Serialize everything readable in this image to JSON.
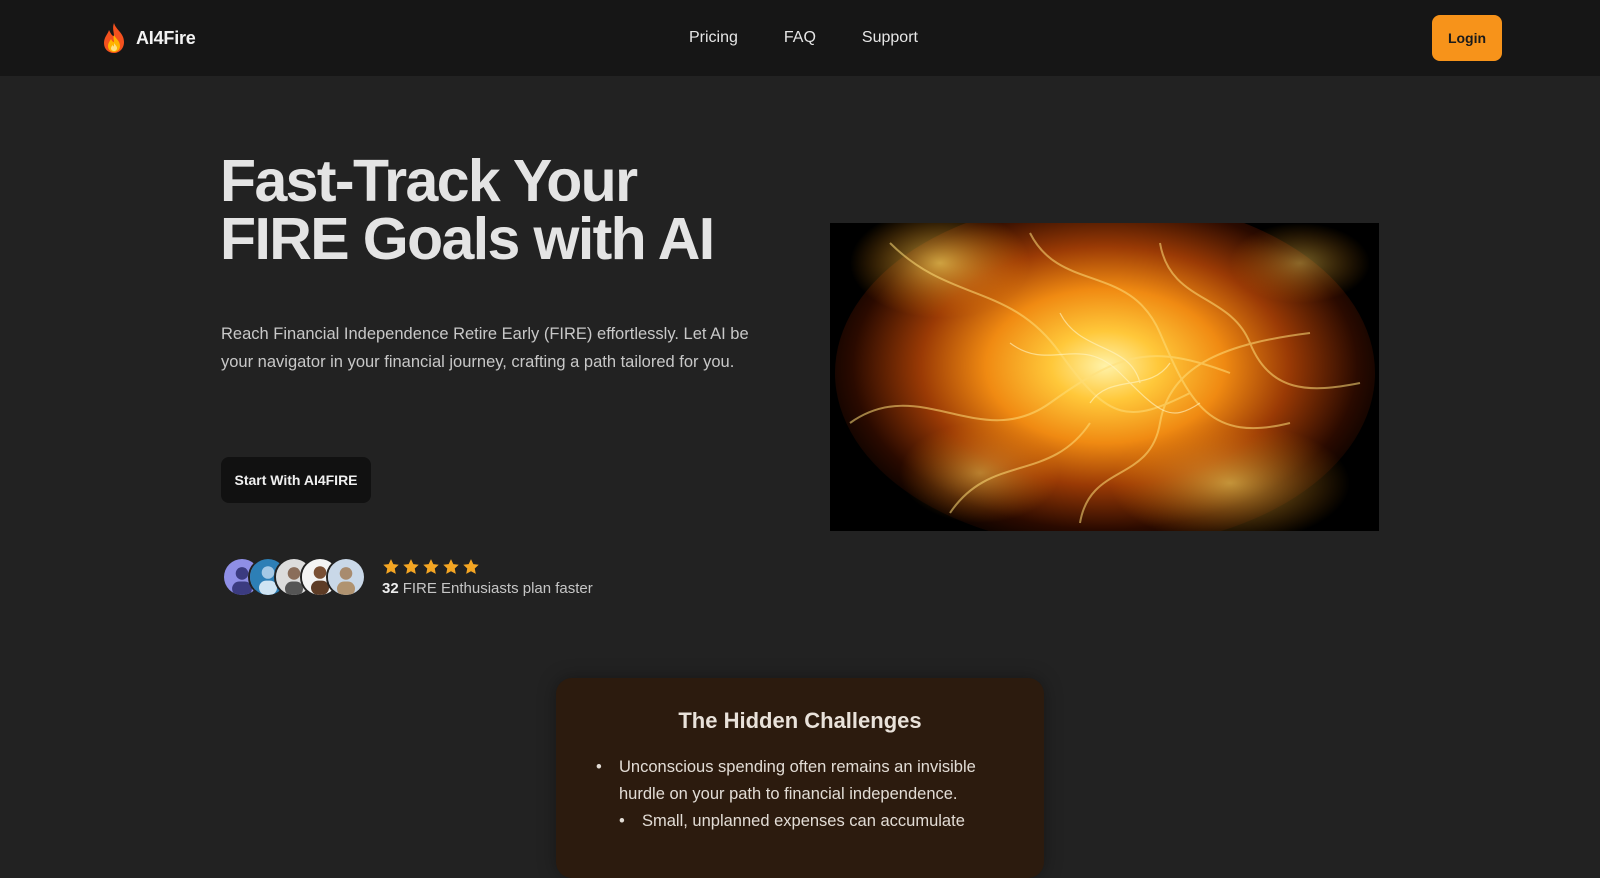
{
  "header": {
    "brand": "AI4Fire",
    "nav": [
      "Pricing",
      "FAQ",
      "Support"
    ],
    "login_label": "Login"
  },
  "hero": {
    "title_line1": "Fast-Track Your",
    "title_line2": "FIRE Goals with AI",
    "description": "Reach Financial Independence Retire Early (FIRE) effortlessly. Let AI be your navigator in your financial journey, crafting a path tailored for you.",
    "cta_label": "Start With AI4FIRE",
    "image_icon": "fire-image"
  },
  "social_proof": {
    "rating": 5,
    "rating_max": 5,
    "count": "32",
    "text": "FIRE Enthusiasts plan faster"
  },
  "challenges": {
    "title": "The Hidden Challenges",
    "items": [
      "Unconscious spending often remains an invisible hurdle on your path to financial independence.",
      "Small, unplanned expenses can accumulate"
    ]
  },
  "colors": {
    "background": "#222222",
    "header": "#161616",
    "accent": "#f7931a",
    "card": "#2c1b0e",
    "star": "#f5a623"
  }
}
